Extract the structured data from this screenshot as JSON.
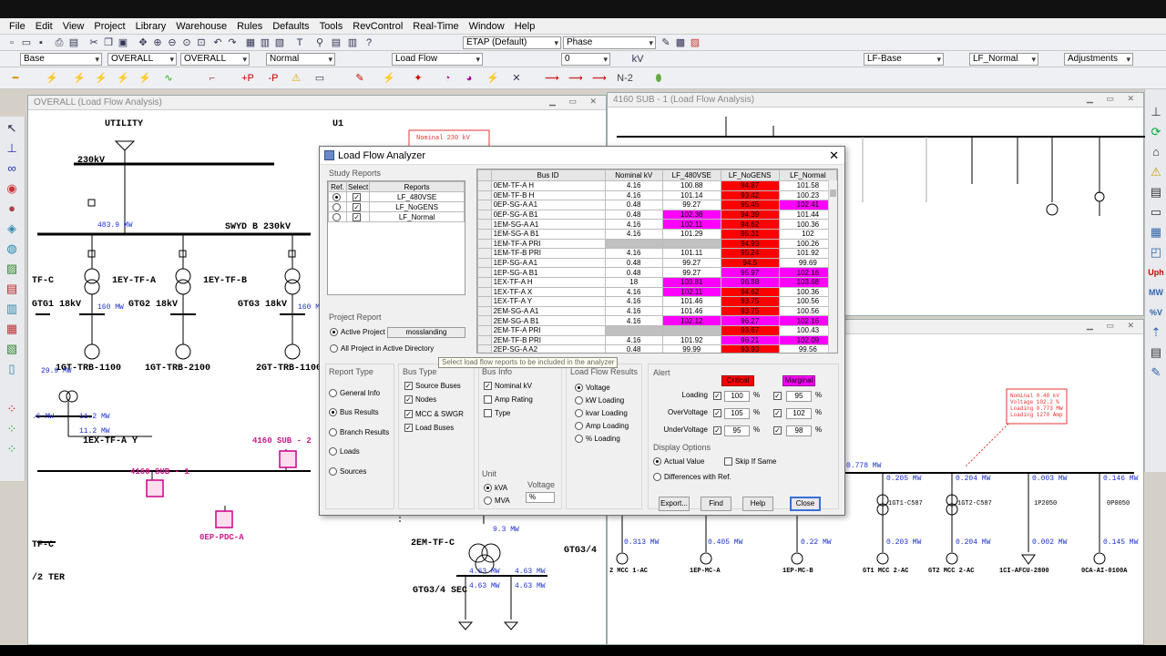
{
  "menu": [
    "File",
    "Edit",
    "View",
    "Project",
    "Library",
    "Warehouse",
    "Rules",
    "Defaults",
    "Tools",
    "RevControl",
    "Real-Time",
    "Window",
    "Help"
  ],
  "toolbar1": {
    "config": "ETAP (Default)",
    "phase": "Phase"
  },
  "toolbar2": {
    "base": "Base",
    "overall1": "OVERALL",
    "overall2": "OVERALL",
    "normal": "Normal",
    "mode": "Load Flow",
    "zero": "0",
    "kv": "kV",
    "study_case": "LF-Base",
    "output": "LF_Normal",
    "adjust": "Adjustments",
    "n2": "N-2"
  },
  "windows": {
    "left_title": "OVERALL (Load Flow Analysis)",
    "right_title": "4160 SUB - 1 (Load Flow Analysis)"
  },
  "oneline": {
    "utility": "UTILITY",
    "u1": "U1",
    "bus230": "230kV",
    "flow1": "483.9 MW",
    "swyd": "SWYD B 230kV",
    "tf_c": "TF-C",
    "ey_tf_a": "1EY-TF-A",
    "ey_tf_b": "1EY-TF-B",
    "gtg1": "GTG1 18kV",
    "gtg2": "GTG2 18kV",
    "gtg3": "GTG3 18kV",
    "mw160a": "160 MW",
    "mw160b": "160 MW",
    "trb1100": "1GT-TRB-1100",
    "trb2100": "1GT-TRB-2100",
    "trb2gt": "2GT-TRB-1100",
    "mw299": "29.9 MW",
    "mw112a": "11.2 MW",
    "mw112b": "11.2 MW",
    "mw6": ".6 MW",
    "ex_tf": "1EX-TF-A Y",
    "sub1": "4160 SUB - 1",
    "sub2": "4160 SUB - 2",
    "pdc": "0EP-PDC-A",
    "tfc2": "TF-C",
    "ter": "/2 TER",
    "em_tf": "2EM-TF-C",
    "gtg34": "GTG3/4",
    "gtg34sec": "GTG3/4 SEC",
    "mw93": "9.3 MW",
    "mw463a": "4.63 MW",
    "mw463b": "4.63 MW",
    "mw463c": "4.63 MW",
    "mw463d": "4.63 MW",
    "nominal_tag": "Nominal  230  kV",
    "right_tag": [
      "Nominal  0.48  kV",
      "Voltage  102.2  %",
      "Loading  0.773  MW",
      "Loading  1270  Amp"
    ],
    "right_bottom": [
      "0.205 MW",
      "0.204 MW",
      "0.003 MW",
      "0.146 MW",
      "1GT1-C587",
      "1GT2-C587",
      "1P2050",
      "0P0050",
      "0.313 MW",
      "0.405 MW",
      "0.22 MW",
      "0.203 MW",
      "0.204 MW",
      "0.002 MW",
      "0.145 MW",
      "2 MCC 1-AC",
      "1EP-MC-A",
      "1EP-MC-B",
      "GT1 MCC 2-AC",
      "GT2 MCC 2-AC",
      "1CI-AFCU-2800",
      "0CA-AI-0100A",
      "0.778 MW"
    ]
  },
  "dialog": {
    "title": "Load Flow Analyzer",
    "study_reports": "Study Reports",
    "rep_headers": [
      "Ref.",
      "Select",
      "Reports"
    ],
    "reports": [
      "LF_480VSE",
      "LF_NoGENS",
      "LF_Normal"
    ],
    "project_report": "Project Report",
    "active_project": "Active Project",
    "project_name": "mosslanding",
    "all_project": "All Project in Active Directory",
    "tooltip": "Select load flow reports to be included in the analyzer",
    "report_type": "Report Type",
    "report_types": [
      "General Info",
      "Bus Results",
      "Branch Results",
      "Loads",
      "Sources"
    ],
    "bus_type": "Bus Type",
    "bus_types": [
      "Source Buses",
      "Nodes",
      "MCC & SWGR",
      "Load Buses"
    ],
    "bus_info": "Bus Info",
    "bus_infos": [
      "Nominal kV",
      "Amp Rating",
      "Type"
    ],
    "lf_results": "Load Flow Results",
    "lf_result_opts": [
      "Voltage",
      "kW Loading",
      "kvar Loading",
      "Amp Loading",
      "% Loading"
    ],
    "unit": "Unit",
    "units": [
      "kVA",
      "MVA"
    ],
    "voltage": "Voltage",
    "voltage_unit": "%",
    "alert": "Alert",
    "critical": "Critical",
    "marginal": "Marginal",
    "alert_rows": [
      {
        "label": "Loading",
        "crit": "100",
        "marg": "95"
      },
      {
        "label": "OverVoltage",
        "crit": "105",
        "marg": "102"
      },
      {
        "label": "UnderVoltage",
        "crit": "95",
        "marg": "98"
      }
    ],
    "pct": "%",
    "display_options": "Display Options",
    "actual_value": "Actual Value",
    "skip_if_same": "Skip If Same",
    "diff_with_ref": "Differences with Ref.",
    "buttons": [
      "Export...",
      "Find",
      "Help",
      "Close"
    ]
  },
  "grid_headers": [
    "Bus ID",
    "Nominal kV",
    "LF_480VSE",
    "LF_NoGENS",
    "LF_Normal"
  ],
  "grid_rows": [
    {
      "id": "0EM-TF-A H",
      "kv": "4.16",
      "a": "100.88",
      "b": "94.87",
      "n": "101.58",
      "ca": "",
      "cb": "red",
      "cn": ""
    },
    {
      "id": "0EM-TF-B H",
      "kv": "4.16",
      "a": "101.14",
      "b": "93.42",
      "n": "100.23",
      "ca": "",
      "cb": "red",
      "cn": ""
    },
    {
      "id": "0EP-SG-A A1",
      "kv": "0.48",
      "a": "99.27",
      "b": "95.45",
      "n": "102.41",
      "ca": "",
      "cb": "red",
      "cn": "mag"
    },
    {
      "id": "0EP-SG-A B1",
      "kv": "0.48",
      "a": "102.38",
      "b": "94.39",
      "n": "101.44",
      "ca": "mag",
      "cb": "red",
      "cn": ""
    },
    {
      "id": "1EM-SG-A A1",
      "kv": "4.16",
      "a": "102.11",
      "b": "94.62",
      "n": "100.36",
      "ca": "mag",
      "cb": "red",
      "cn": ""
    },
    {
      "id": "1EM-SG-A B1",
      "kv": "4.16",
      "a": "101.29",
      "b": "95.31",
      "n": "102",
      "ca": "",
      "cb": "red",
      "cn": ""
    },
    {
      "id": "1EM-TF-A PRI",
      "kv": "",
      "a": "",
      "b": "94.93",
      "n": "100.26",
      "ca": "gry",
      "cb": "red",
      "cn": ""
    },
    {
      "id": "1EM-TF-B PRI",
      "kv": "4.16",
      "a": "101.11",
      "b": "95.24",
      "n": "101.92",
      "ca": "",
      "cb": "red",
      "cn": ""
    },
    {
      "id": "1EP-SG-A A1",
      "kv": "0.48",
      "a": "99.27",
      "b": "94.5",
      "n": "99.69",
      "ca": "",
      "cb": "red",
      "cn": ""
    },
    {
      "id": "1EP-SG-A B1",
      "kv": "0.48",
      "a": "99.27",
      "b": "95.97",
      "n": "102.16",
      "ca": "",
      "cb": "mag",
      "cn": "mag"
    },
    {
      "id": "1EX-TF-A H",
      "kv": "18",
      "a": "103.81",
      "b": "96.88",
      "n": "103.68",
      "ca": "mag",
      "cb": "mag",
      "cn": "mag"
    },
    {
      "id": "1EX-TF-A X",
      "kv": "4.16",
      "a": "102.11",
      "b": "94.62",
      "n": "100.36",
      "ca": "mag",
      "cb": "red",
      "cn": ""
    },
    {
      "id": "1EX-TF-A Y",
      "kv": "4.16",
      "a": "101.46",
      "b": "93.75",
      "n": "100.56",
      "ca": "",
      "cb": "red",
      "cn": ""
    },
    {
      "id": "2EM-SG-A A1",
      "kv": "4.16",
      "a": "101.46",
      "b": "93.75",
      "n": "100.56",
      "ca": "",
      "cb": "red",
      "cn": ""
    },
    {
      "id": "2EM-SG-A B1",
      "kv": "4.16",
      "a": "102.12",
      "b": "96.27",
      "n": "102.16",
      "ca": "mag",
      "cb": "mag",
      "cn": "mag"
    },
    {
      "id": "2EM-TF-A PRI",
      "kv": "",
      "a": "",
      "b": "93.67",
      "n": "100.43",
      "ca": "gry",
      "cb": "red",
      "cn": ""
    },
    {
      "id": "2EM-TF-B PRI",
      "kv": "4.16",
      "a": "101.92",
      "b": "96.21",
      "n": "102.09",
      "ca": "",
      "cb": "mag",
      "cn": "mag"
    },
    {
      "id": "2EP-SG-A A2",
      "kv": "0.48",
      "a": "99.99",
      "b": "93.93",
      "n": "99.56",
      "ca": "",
      "cb": "red",
      "cn": ""
    }
  ]
}
